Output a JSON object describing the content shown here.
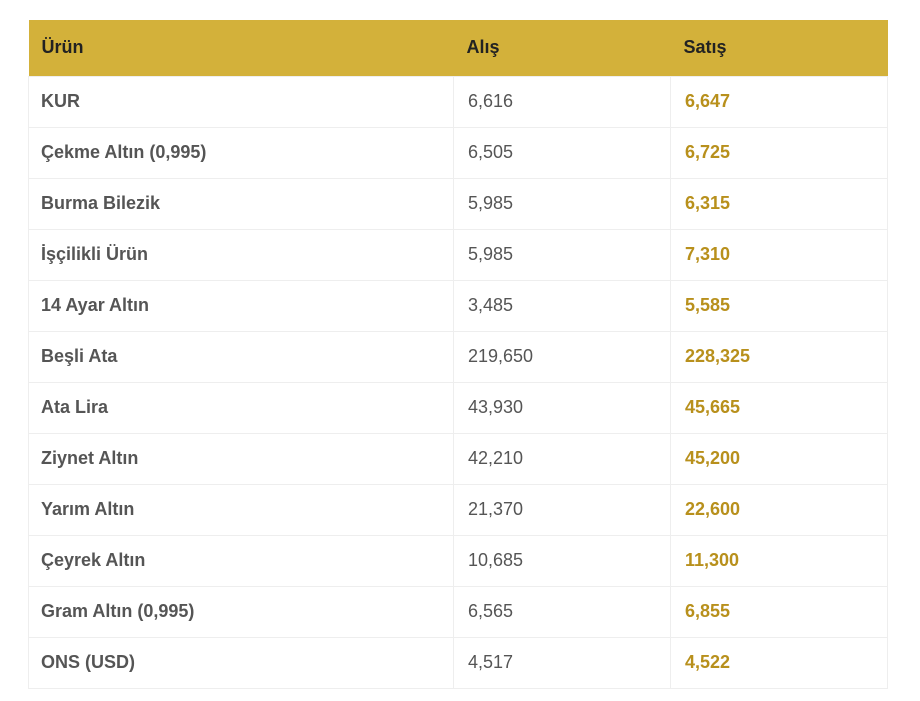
{
  "table": {
    "headers": {
      "product": "Ürün",
      "buy": "Alış",
      "sell": "Satış"
    },
    "rows": [
      {
        "product": "KUR",
        "buy": "6,616",
        "sell": "6,647"
      },
      {
        "product": "Çekme Altın (0,995)",
        "buy": "6,505",
        "sell": "6,725"
      },
      {
        "product": "Burma Bilezik",
        "buy": "5,985",
        "sell": "6,315"
      },
      {
        "product": "İşçilikli Ürün",
        "buy": "5,985",
        "sell": "7,310"
      },
      {
        "product": "14 Ayar Altın",
        "buy": "3,485",
        "sell": "5,585"
      },
      {
        "product": "Beşli Ata",
        "buy": "219,650",
        "sell": "228,325"
      },
      {
        "product": "Ata Lira",
        "buy": "43,930",
        "sell": "45,665"
      },
      {
        "product": "Ziynet Altın",
        "buy": "42,210",
        "sell": "45,200"
      },
      {
        "product": "Yarım Altın",
        "buy": "21,370",
        "sell": "22,600"
      },
      {
        "product": "Çeyrek Altın",
        "buy": "10,685",
        "sell": "11,300"
      },
      {
        "product": "Gram Altın (0,995)",
        "buy": "6,565",
        "sell": "6,855"
      },
      {
        "product": "ONS (USD)",
        "buy": "4,517",
        "sell": "4,522"
      }
    ]
  },
  "colors": {
    "header_bg": "#d3b13a",
    "sell_text": "#b8901c",
    "body_text": "#555555"
  }
}
